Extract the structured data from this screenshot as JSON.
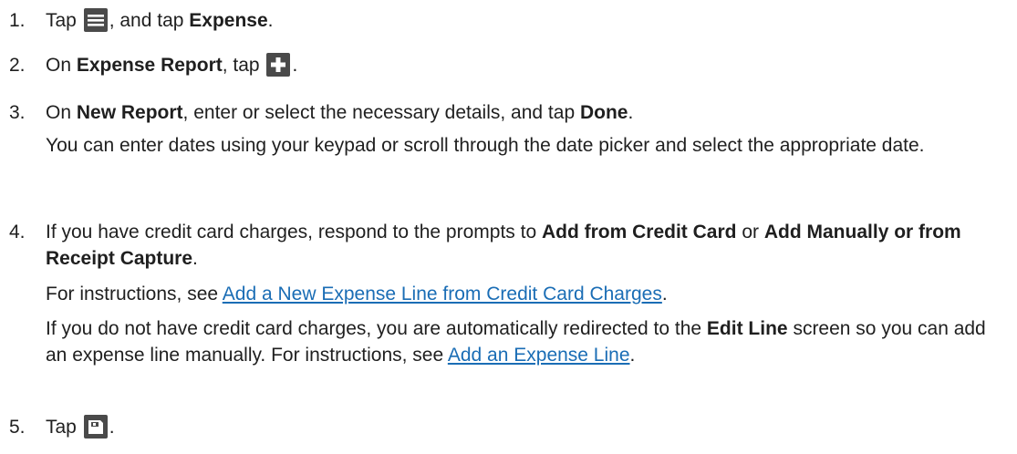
{
  "steps": [
    {
      "num": "1.",
      "t1": "Tap",
      "t2": ", and tap",
      "b1": "Expense",
      "t3": ".",
      "icon": "hamburger-menu-icon"
    },
    {
      "num": "2.",
      "t1": "On",
      "b1": "Expense Report",
      "t2": ", tap",
      "t3": ".",
      "icon": "plus-icon"
    },
    {
      "num": "3.",
      "t1": "On",
      "b1": "New Report",
      "t2": ", enter or select the necessary details, and tap",
      "b2": "Done",
      "t3": ".",
      "note": "You can enter dates using your keypad or scroll through the date picker and select the appropriate date."
    },
    {
      "num": "4.",
      "t1": "If you have credit card charges, respond to the prompts to",
      "b1": "Add from Credit Card",
      "t2": "or",
      "b2": "Add Manually or from Receipt Capture",
      "t3": ".",
      "p1_pre": "For instructions, see",
      "p1_link": "Add a New Expense Line from Credit Card Charges",
      "p1_post": ".",
      "p2_pre": "If you do not have credit card charges, you are automatically redirected to the",
      "p2_bold": "Edit Line",
      "p2_mid": "screen so you can add an expense line manually. For instructions, see",
      "p2_link": "Add an Expense Line",
      "p2_post": "."
    },
    {
      "num": "5.",
      "t1": "Tap",
      "t3": ".",
      "icon": "save-icon"
    }
  ]
}
